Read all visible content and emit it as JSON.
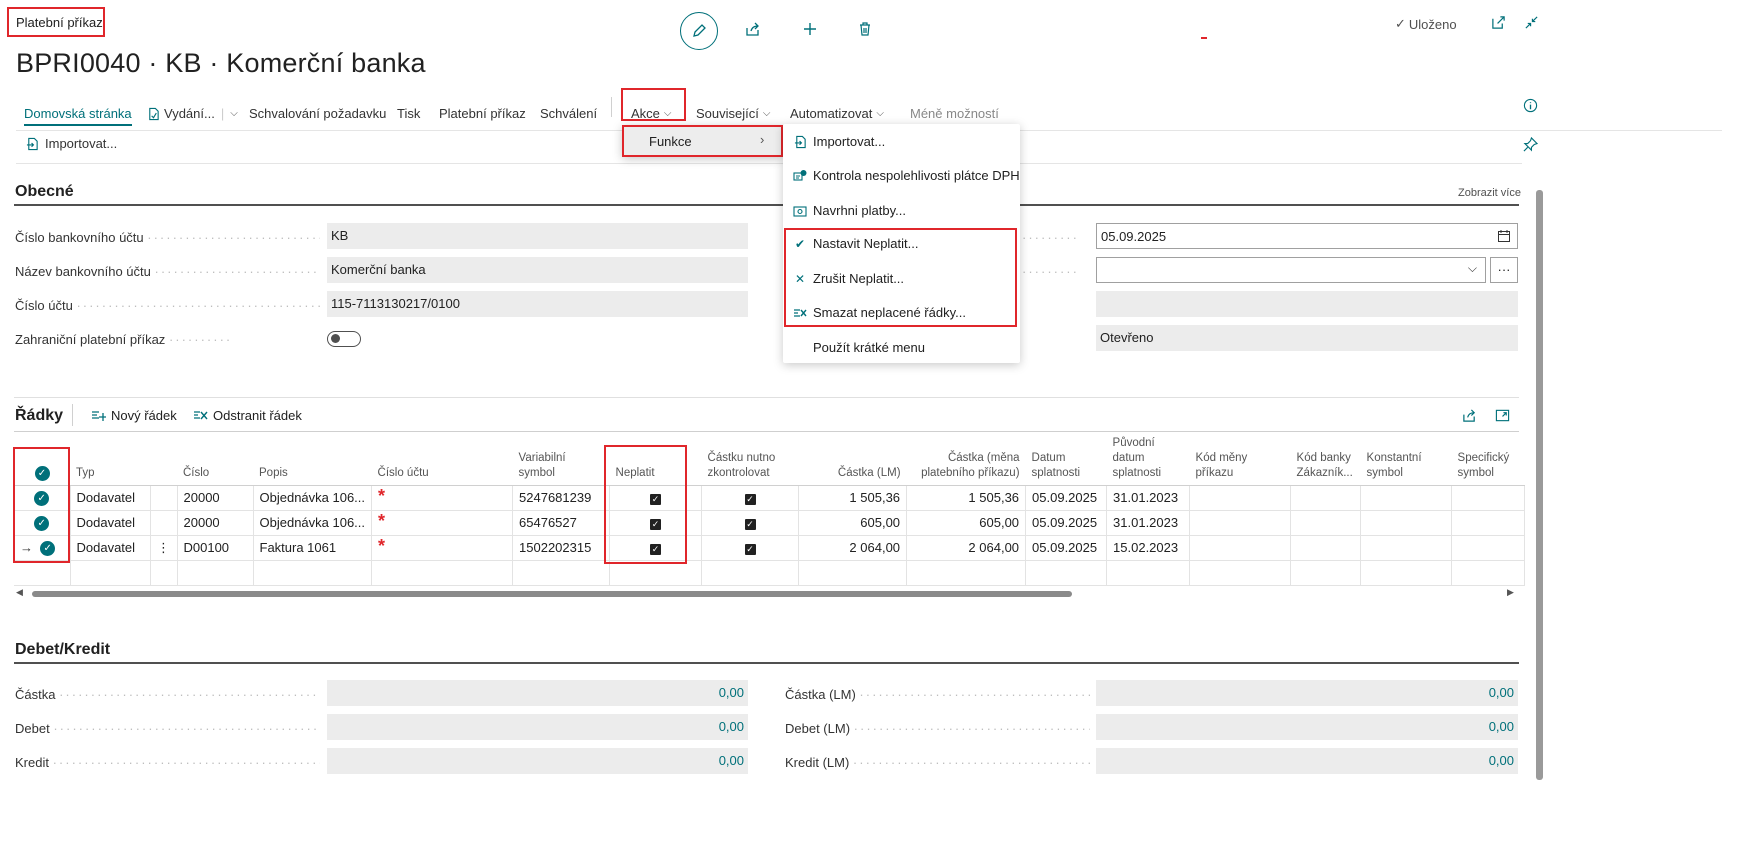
{
  "caption": "Platební příkaz",
  "title": "BPRI0040 · KB · Komerční banka",
  "status": {
    "saved_label": "Uloženo"
  },
  "actionbar": {
    "items": [
      {
        "label": "Domovská stránka"
      },
      {
        "label": "Vydání..."
      },
      {
        "label": "Schvalování požadavku"
      },
      {
        "label": "Tisk"
      },
      {
        "label": "Platební příkaz"
      },
      {
        "label": "Schválení"
      },
      {
        "label": "Akce"
      },
      {
        "label": "Související"
      },
      {
        "label": "Automatizovat"
      },
      {
        "label": "Méně možností"
      }
    ],
    "sub_import": "Importovat..."
  },
  "submenu": {
    "funkce": "Funkce"
  },
  "functions_menu": {
    "items": [
      {
        "label": "Importovat...",
        "icon": "import-icon"
      },
      {
        "label": "Kontrola nespolehlivosti plátce DPH",
        "icon": "vat-check-icon"
      },
      {
        "label": "Navrhni platby...",
        "icon": "suggest-payments-icon"
      },
      {
        "label": "Nastavit Neplatit...",
        "icon": "checkmark-icon"
      },
      {
        "label": "Zrušit Neplatit...",
        "icon": "cross-icon"
      },
      {
        "label": "Smazat neplacené řádky...",
        "icon": "delete-lines-icon"
      },
      {
        "label": "Použít krátké menu",
        "icon": ""
      }
    ]
  },
  "general": {
    "title": "Obecné",
    "show_more": "Zobrazit více",
    "fields": [
      {
        "label": "Číslo bankovního účtu",
        "value": "KB"
      },
      {
        "label": "Název bankovního účtu",
        "value": "Komerční banka"
      },
      {
        "label": "Číslo účtu",
        "value": "115-7113130217/0100"
      },
      {
        "label": "Zahraniční platební příkaz",
        "value": ""
      }
    ],
    "right_values": {
      "date": "05.09.2025",
      "dropdown": "",
      "empty": "",
      "state": "Otevřeno"
    }
  },
  "lines": {
    "title": "Řádky",
    "new_line": "Nový řádek",
    "delete_line": "Odstranit řádek",
    "columns": [
      "Typ",
      "Číslo",
      "Popis",
      "Číslo účtu",
      "Variabilní symbol",
      "Neplatit",
      "Částku nutno zkontrolovat",
      "Částka (LM)",
      "Částka (měna platebního příkazu)",
      "Datum splatnosti",
      "Původní datum splatnosti",
      "Kód měny příkazu",
      "Kód banky Zákazník...",
      "Konstantní symbol",
      "Specifický symbol"
    ],
    "rows": [
      {
        "typ": "Dodavatel",
        "cislo": "20000",
        "popis": "Objednávka 106...",
        "vs": "5247681239",
        "castka_lm": "1 505,36",
        "castka_mena": "1 505,36",
        "datum": "05.09.2025",
        "puvodni": "31.01.2023"
      },
      {
        "typ": "Dodavatel",
        "cislo": "20000",
        "popis": "Objednávka 106...",
        "vs": "65476527",
        "castka_lm": "605,00",
        "castka_mena": "605,00",
        "datum": "05.09.2025",
        "puvodni": "31.01.2023"
      },
      {
        "typ": "Dodavatel",
        "cislo": "D00100",
        "popis": "Faktura 1061",
        "vs": "1502202315",
        "castka_lm": "2 064,00",
        "castka_mena": "2 064,00",
        "datum": "05.09.2025",
        "puvodni": "15.02.2023"
      }
    ]
  },
  "debit_credit": {
    "title": "Debet/Kredit",
    "left": [
      {
        "label": "Částka",
        "value": "0,00"
      },
      {
        "label": "Debet",
        "value": "0,00"
      },
      {
        "label": "Kredit",
        "value": "0,00"
      }
    ],
    "right": [
      {
        "label": "Částka (LM)",
        "value": "0,00"
      },
      {
        "label": "Debet (LM)",
        "value": "0,00"
      },
      {
        "label": "Kredit (LM)",
        "value": "0,00"
      }
    ]
  },
  "colors": {
    "accent": "#00707a",
    "highlight": "#e0262b"
  }
}
